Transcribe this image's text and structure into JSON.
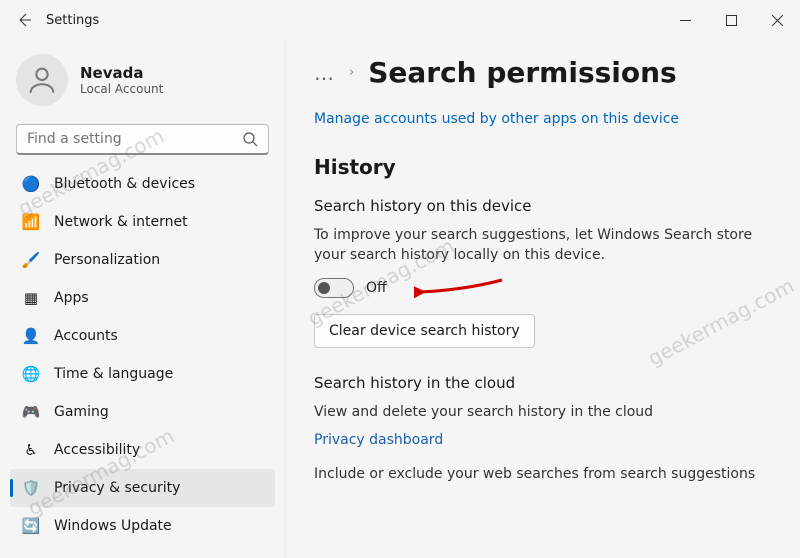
{
  "window": {
    "title": "Settings"
  },
  "profile": {
    "name": "Nevada",
    "sub": "Local Account"
  },
  "search": {
    "placeholder": "Find a setting"
  },
  "sidebar": {
    "items": [
      {
        "label": "Bluetooth & devices",
        "icon": "🔵"
      },
      {
        "label": "Network & internet",
        "icon": "📶"
      },
      {
        "label": "Personalization",
        "icon": "🖌️"
      },
      {
        "label": "Apps",
        "icon": "▦"
      },
      {
        "label": "Accounts",
        "icon": "👤"
      },
      {
        "label": "Time & language",
        "icon": "🌐"
      },
      {
        "label": "Gaming",
        "icon": "🎮"
      },
      {
        "label": "Accessibility",
        "icon": "♿"
      },
      {
        "label": "Privacy & security",
        "icon": "🛡️"
      },
      {
        "label": "Windows Update",
        "icon": "🔄"
      }
    ],
    "selected_index": 8
  },
  "breadcrumb": {
    "dots": "…",
    "title": "Search permissions"
  },
  "links": {
    "manage_accounts": "Manage accounts used by other apps on this device",
    "privacy_dashboard": "Privacy dashboard"
  },
  "history": {
    "heading": "History",
    "device_heading": "Search history on this device",
    "device_desc": "To improve your search suggestions, let Windows Search store your search history locally on this device.",
    "toggle_state": "Off",
    "clear_button": "Clear device search history",
    "cloud_heading": "Search history in the cloud",
    "cloud_desc": "View and delete your search history in the cloud",
    "include_desc": "Include or exclude your web searches from search suggestions"
  },
  "watermark": "geekermag.com"
}
